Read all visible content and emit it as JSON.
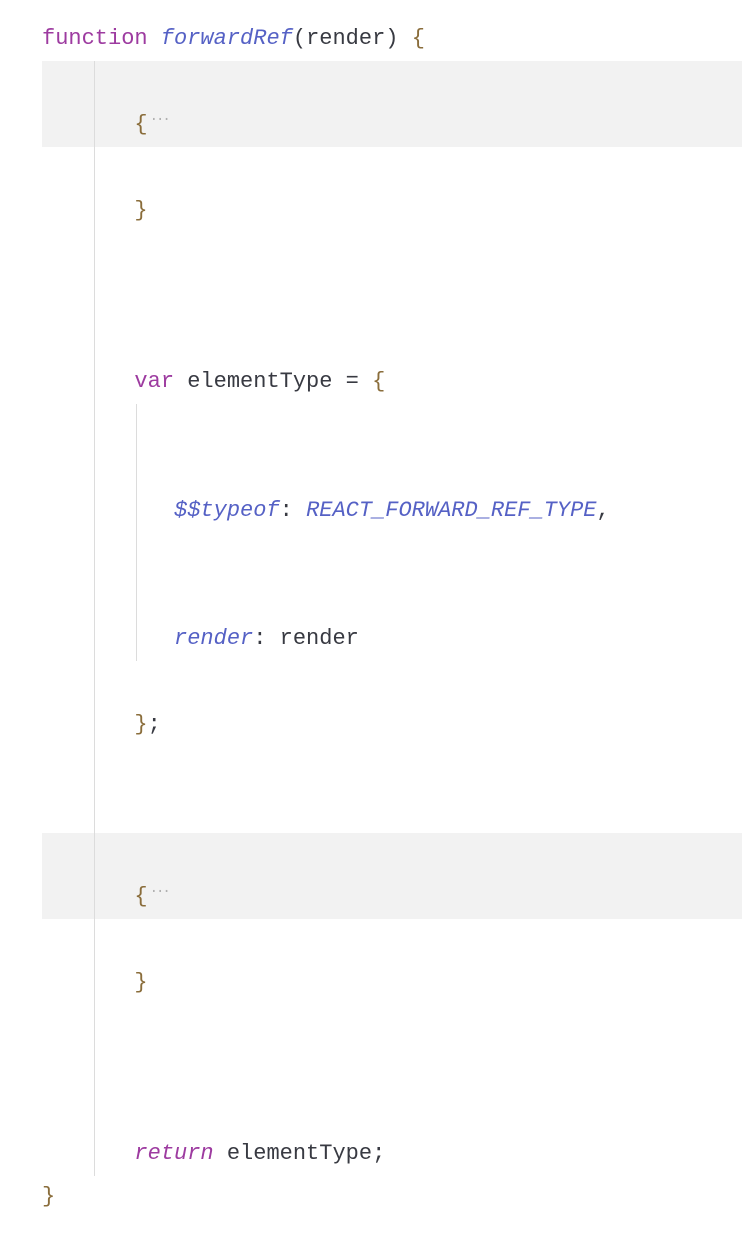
{
  "code": {
    "line1": {
      "keyword": "function",
      "functionName": "forwardRef",
      "param": "render"
    },
    "line2": {
      "brace": "{",
      "foldMarker": "···"
    },
    "line3": {
      "brace": "}"
    },
    "line5": {
      "varKeyword": "var",
      "identifier": "elementType",
      "operator": "=",
      "brace": "{"
    },
    "line6": {
      "property": "$$typeof",
      "value": "REACT_FORWARD_REF_TYPE"
    },
    "line7": {
      "property": "render",
      "value": "render"
    },
    "line8": {
      "brace": "}",
      "semicolon": ";"
    },
    "line10": {
      "brace": "{",
      "foldMarker": "···"
    },
    "line11": {
      "brace": "}"
    },
    "line13": {
      "returnKeyword": "return",
      "identifier": "elementType",
      "semicolon": ";"
    },
    "line14": {
      "brace": "}"
    }
  }
}
